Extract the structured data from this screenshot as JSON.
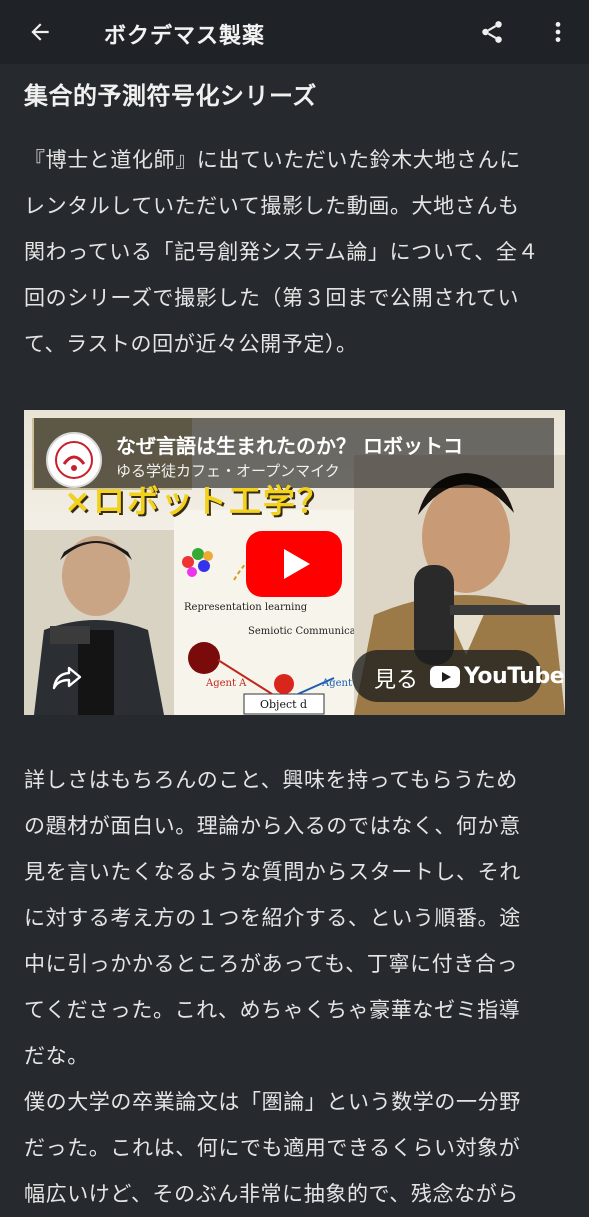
{
  "appbar": {
    "title": "ボクデマス製薬",
    "back_icon": "arrow-left-icon",
    "share_icon": "share-icon",
    "more_icon": "more-vertical-icon"
  },
  "post": {
    "title": "集合的予測符号化シリーズ",
    "paragraph1_lines": [
      "『博士と道化師』に出ていただいた鈴木大地さんに",
      "レンタルしていただいて撮影した動画。大地さんも",
      "関わっている「記号創発システム論」について、全４",
      "回のシリーズで撮影した（第３回まで公開されてい",
      "て、ラストの回が近々公開予定）。"
    ],
    "paragraph2_lines": [
      "詳しさはもちろんのこと、興味を持ってもらうため",
      "の題材が面白い。理論から入るのではなく、何か意",
      "見を言いたくなるような質問からスタートし、それ",
      "に対する考え方の１つを紹介する、という順番。途",
      "中に引っかかるところがあっても、丁寧に付き合っ",
      "てくださった。これ、めちゃくちゃ豪華なゼミ指導",
      "だな。"
    ],
    "paragraph3_lines": [
      "僕の大学の卒業論文は「圏論」という数学の一分野",
      "だった。これは、何にでも適用できるくらい対象が",
      "幅広いけど、そのぶん非常に抽象的で、残念ながら"
    ]
  },
  "video": {
    "title": "なぜ言語は生まれたのか？ ロボットコ",
    "channel": "ゆる学徒カフェ・オープンマイク",
    "caption": "×ロボット工学？",
    "diagram_labels": [
      "Representation learning",
      "Semiotic Communication",
      "Agent A",
      "Agent",
      "Object d"
    ],
    "watch_label": "見る",
    "youtube_word": "YouTube",
    "play_icon": "play-icon",
    "share_icon": "share-arrow-icon",
    "colors": {
      "play_red": "#ff0000",
      "caption_yellow": "#f2d21c"
    }
  }
}
